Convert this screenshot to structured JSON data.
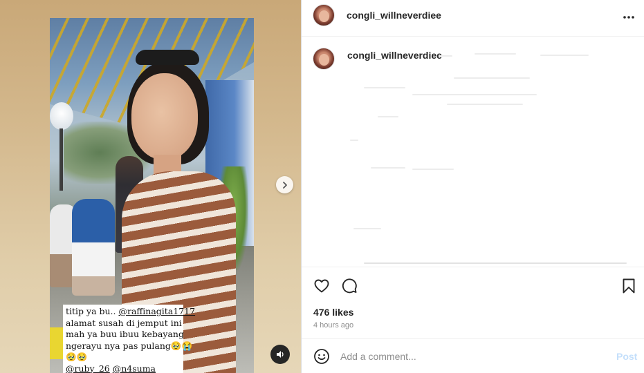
{
  "post": {
    "username": "congli_willneverdiee",
    "caption_author": "congli_willneverdiee",
    "likes": "476 likes",
    "timestamp": "4 hours ago"
  },
  "media": {
    "caption_lines": [
      "titip ya bu.. ",
      "@raffinagita1717",
      "alamat susah di jemput ini",
      "mah ya buu ibuu kebayang",
      "ngerayu nya pas pulang🥹😭",
      "🥹🥹",
      "@ruby_26",
      "@n4suma"
    ]
  },
  "comment_box": {
    "placeholder": "Add a comment...",
    "post_label": "Post"
  },
  "icons": {
    "more": "more-options-icon",
    "like": "heart-icon",
    "comment": "comment-icon",
    "save": "bookmark-icon",
    "emoji": "emoji-icon",
    "next": "chevron-right-icon",
    "mute": "speaker-icon"
  },
  "colors": {
    "text": "#262626",
    "muted": "#8e8e8e",
    "post_disabled": "#c4dffb",
    "divider": "#efefef"
  }
}
